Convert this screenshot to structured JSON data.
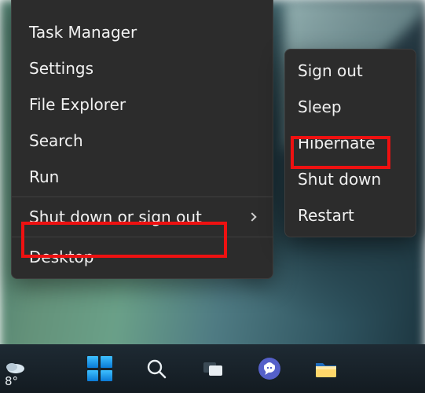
{
  "weather": {
    "temp": "8°"
  },
  "main_menu": {
    "items": [
      {
        "label": "Task Manager"
      },
      {
        "label": "Settings"
      },
      {
        "label": "File Explorer"
      },
      {
        "label": "Search"
      },
      {
        "label": "Run"
      }
    ],
    "submenu_trigger": {
      "label": "Shut down or sign out"
    },
    "items_after": [
      {
        "label": "Desktop"
      }
    ]
  },
  "sub_menu": {
    "items": [
      {
        "label": "Sign out"
      },
      {
        "label": "Sleep"
      },
      {
        "label": "Hibernate"
      },
      {
        "label": "Shut down"
      },
      {
        "label": "Restart"
      }
    ]
  },
  "taskbar": {
    "icons": [
      "start",
      "search",
      "task-view",
      "chat",
      "file-explorer"
    ]
  },
  "annotations": {
    "main_highlight_index": 5,
    "sub_highlight_index": 2
  }
}
